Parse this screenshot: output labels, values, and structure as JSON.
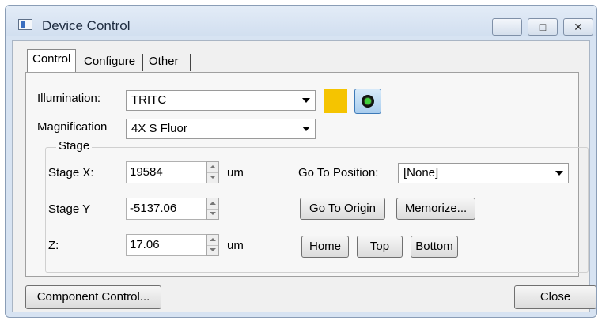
{
  "window": {
    "title": "Device Control",
    "icon": "app-window-icon",
    "controls": {
      "minimize": "–",
      "maximize": "□",
      "close": "✕"
    }
  },
  "tabs": [
    {
      "label": "Control",
      "active": true
    },
    {
      "label": "Configure",
      "active": false
    },
    {
      "label": "Other",
      "active": false
    }
  ],
  "illumination": {
    "label": "Illumination:",
    "value": "TRITC",
    "swatch_color": "#f5c400",
    "toggle_icon": "shutter-indicator-icon"
  },
  "magnification": {
    "label": "Magnification",
    "value": "4X S Fluor"
  },
  "stage": {
    "group_label": "Stage",
    "x": {
      "label": "Stage X:",
      "value": "19584",
      "unit": "um"
    },
    "y": {
      "label": "Stage Y",
      "value": "-5137.06"
    },
    "z": {
      "label": "Z:",
      "value": "17.06",
      "unit": "um"
    },
    "go_to_position": {
      "label": "Go To Position:",
      "value": "[None]"
    },
    "buttons": {
      "go_to_origin": "Go To Origin",
      "memorize": "Memorize...",
      "home": "Home",
      "top": "Top",
      "bottom": "Bottom"
    }
  },
  "footer": {
    "component_control": "Component Control...",
    "close": "Close"
  }
}
